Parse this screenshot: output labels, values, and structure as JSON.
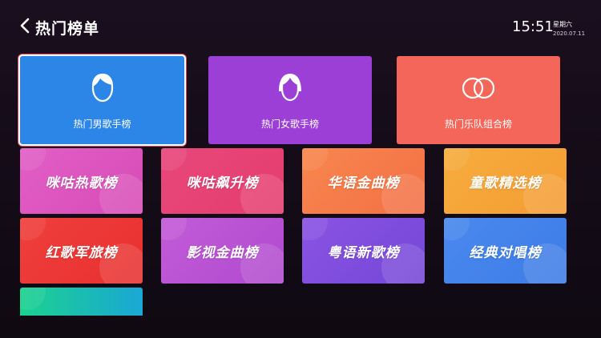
{
  "header": {
    "title": "热门榜单",
    "time": "15:51",
    "weekday": "星期六",
    "date": "2020.07.11"
  },
  "featured": [
    {
      "label": "热门男歌手榜",
      "icon": "male-avatar-icon",
      "color": "#2c86e8"
    },
    {
      "label": "热门女歌手榜",
      "icon": "female-avatar-icon",
      "color": "#9b3fd6"
    },
    {
      "label": "热门乐队组合榜",
      "icon": "rings-icon",
      "color": "#f4665a"
    }
  ],
  "charts": [
    {
      "label": "咪咕热歌榜",
      "colors": [
        "#e15fc6",
        "#d84bb6"
      ]
    },
    {
      "label": "咪咕飙升榜",
      "colors": [
        "#e8477c",
        "#e53d6d"
      ]
    },
    {
      "label": "华语金曲榜",
      "colors": [
        "#f8874e",
        "#f36f45"
      ]
    },
    {
      "label": "童歌精选榜",
      "colors": [
        "#f7ad3d",
        "#f49c33"
      ]
    },
    {
      "label": "红歌军旅榜",
      "colors": [
        "#ef3f3c",
        "#e8302f"
      ]
    },
    {
      "label": "影视金曲榜",
      "colors": [
        "#c35bd8",
        "#b04ace"
      ]
    },
    {
      "label": "粤语新歌榜",
      "colors": [
        "#8a53e3",
        "#7547d7"
      ]
    },
    {
      "label": "经典对唱榜",
      "colors": [
        "#4a89ee",
        "#3d7ce6"
      ]
    }
  ],
  "partial_card": {
    "colors": [
      "#1bd28e",
      "#1aa7d6"
    ]
  }
}
